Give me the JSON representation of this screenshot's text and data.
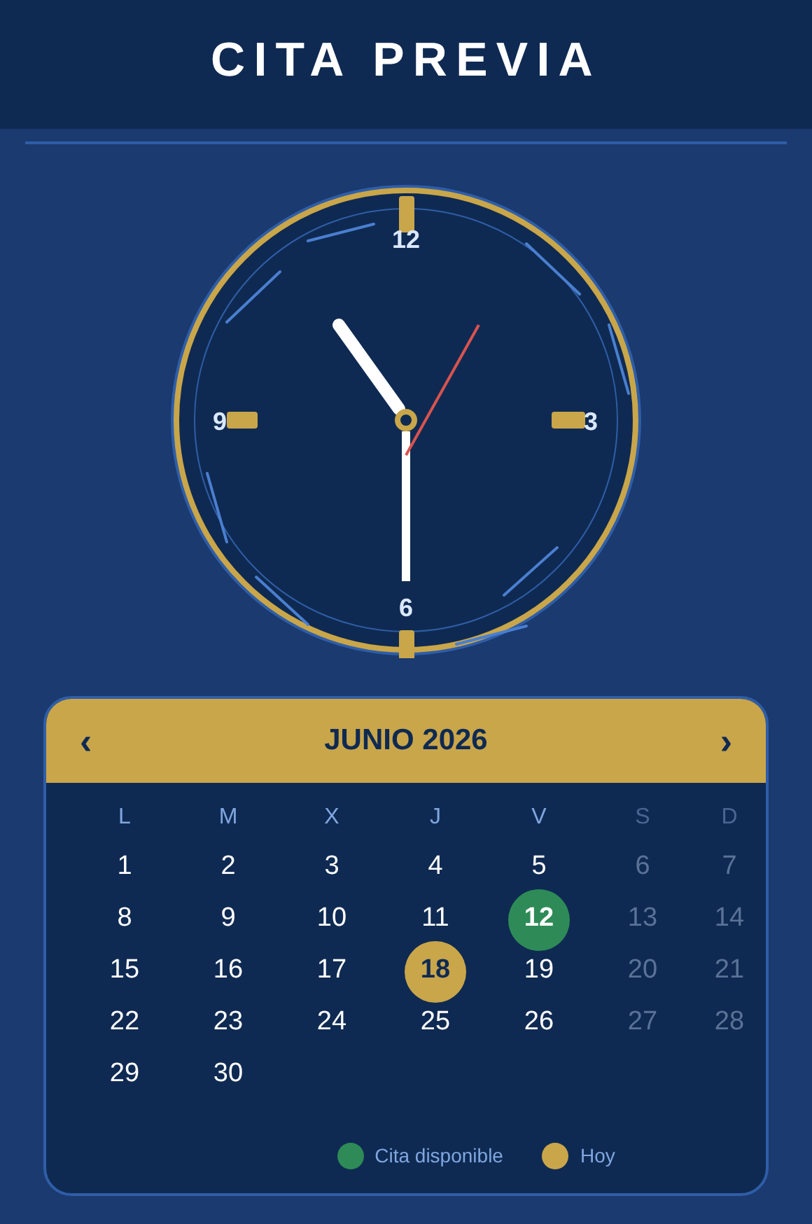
{
  "header": {
    "title": "CITA PREVIA"
  },
  "clock": {
    "numerals": [
      "12",
      "9",
      "3",
      "6"
    ]
  },
  "calendar": {
    "prev": "‹",
    "title": "JUNIO 2026",
    "next": "›",
    "weekdays": [
      {
        "text": "L",
        "kind": "weekday"
      },
      {
        "text": "M",
        "kind": "weekday"
      },
      {
        "text": "X",
        "kind": "weekday"
      },
      {
        "text": "J",
        "kind": "weekday"
      },
      {
        "text": "V",
        "kind": "weekday"
      },
      {
        "text": "S",
        "kind": "weekend"
      },
      {
        "text": "D",
        "kind": "weekend"
      }
    ],
    "days": [
      {
        "text": "1",
        "kind": "weekday"
      },
      {
        "text": "2",
        "kind": "weekday"
      },
      {
        "text": "3",
        "kind": "weekday"
      },
      {
        "text": "4",
        "kind": "weekday"
      },
      {
        "text": "5",
        "kind": "weekday"
      },
      {
        "text": "6",
        "kind": "weekend"
      },
      {
        "text": "7",
        "kind": "weekend"
      },
      {
        "text": "8",
        "kind": "weekday"
      },
      {
        "text": "9",
        "kind": "weekday"
      },
      {
        "text": "10",
        "kind": "weekday"
      },
      {
        "text": "11",
        "kind": "weekday"
      },
      {
        "text": "12",
        "kind": "available"
      },
      {
        "text": "13",
        "kind": "weekend"
      },
      {
        "text": "14",
        "kind": "weekend"
      },
      {
        "text": "15",
        "kind": "weekday"
      },
      {
        "text": "16",
        "kind": "weekday"
      },
      {
        "text": "17",
        "kind": "weekday"
      },
      {
        "text": "18",
        "kind": "today"
      },
      {
        "text": "19",
        "kind": "weekday"
      },
      {
        "text": "20",
        "kind": "weekend"
      },
      {
        "text": "21",
        "kind": "weekend"
      },
      {
        "text": "22",
        "kind": "weekday"
      },
      {
        "text": "23",
        "kind": "weekday"
      },
      {
        "text": "24",
        "kind": "weekday"
      },
      {
        "text": "25",
        "kind": "weekday"
      },
      {
        "text": "26",
        "kind": "weekday"
      },
      {
        "text": "27",
        "kind": "weekend"
      },
      {
        "text": "28",
        "kind": "weekend"
      },
      {
        "text": "29",
        "kind": "weekday"
      },
      {
        "text": "30",
        "kind": "weekday"
      }
    ],
    "legend": [
      {
        "text": "Cita disponible",
        "color": "#2e8b57"
      },
      {
        "text": "Hoy",
        "color": "#c9a64a"
      }
    ]
  }
}
